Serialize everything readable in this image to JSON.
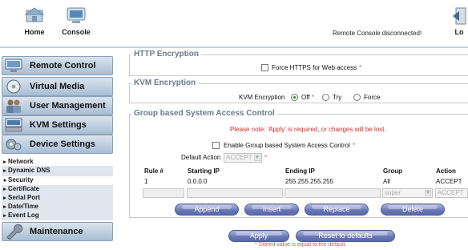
{
  "header": {
    "home_label": "Home",
    "console_label": "Console",
    "status": "Remote Console disconnected!",
    "logout_label": "Lo"
  },
  "sidebar": {
    "main_items": [
      {
        "label": "Remote Control",
        "icon": "monitor-icon"
      },
      {
        "label": "Virtual Media",
        "icon": "disc-icon"
      },
      {
        "label": "User Management",
        "icon": "users-icon"
      },
      {
        "label": "KVM Settings",
        "icon": "keyboard-icon"
      },
      {
        "label": "Device Settings",
        "icon": "device-settings-icon"
      },
      {
        "label": "Maintenance",
        "icon": "wrench-icon"
      }
    ],
    "sub_items": [
      {
        "label": "Network",
        "active": false
      },
      {
        "label": "Dynamic DNS",
        "active": false
      },
      {
        "label": "Security",
        "active": true
      },
      {
        "label": "Certificate",
        "active": false
      },
      {
        "label": "Serial Port",
        "active": false
      },
      {
        "label": "Date/Time",
        "active": false
      },
      {
        "label": "Event Log",
        "active": false
      }
    ]
  },
  "http_section": {
    "title": "HTTP Encryption",
    "force_https_label": "Force HTTPS for Web access",
    "star": "*"
  },
  "kvm_section": {
    "title": "KVM Encryption",
    "label": "KVM Encryption",
    "options": [
      "Off",
      "Try",
      "Force"
    ],
    "selected": "Off",
    "star": "*"
  },
  "group_section": {
    "title": "Group based System Access Control",
    "note": "Please note: 'Apply' is required, or changes will be lost.",
    "enable_label": "Enable Group based System Access Control",
    "star": "*",
    "default_action_label": "Default Action",
    "default_action_value": "ACCEPT",
    "columns": [
      "Rule #",
      "Starting IP",
      "Ending IP",
      "Group",
      "Action"
    ],
    "rows": [
      {
        "rule": "1",
        "start_ip": "0.0.0.0",
        "end_ip": "255.255.255.255",
        "group": "All",
        "action": "ACCEPT"
      }
    ],
    "new_row": {
      "group": "super",
      "action": "ACCEPT"
    },
    "buttons": [
      "Append",
      "Insert",
      "Replace",
      "Delete"
    ]
  },
  "footer": {
    "apply_label": "Apply",
    "reset_label": "Reset to defaults",
    "note": "* Stored value is equal to the default."
  },
  "colors": {
    "accent": "#6b78b7",
    "legend": "#6a7a8c",
    "warning": "#d32a2a"
  }
}
